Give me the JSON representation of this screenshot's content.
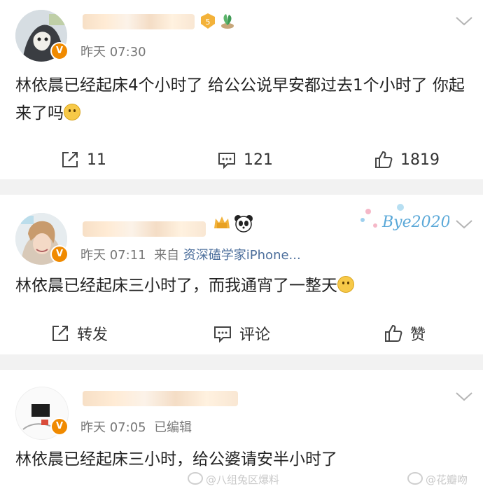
{
  "posts": [
    {
      "time": "昨天 07:30",
      "content": "林依晨已经起床4个小时了 给公公说早安都过去1个小时了 你起来了吗",
      "actions": {
        "repost": "11",
        "comment": "121",
        "like": "1819"
      }
    },
    {
      "time": "昨天 07:11",
      "source_prefix": "来自",
      "source": "资深磕学家iPhone...",
      "content": "林依晨已经起床三小时了，而我通宵了一整天",
      "card_label": "Bye2020",
      "actions": {
        "repost": "转发",
        "comment": "评论",
        "like": "赞"
      }
    },
    {
      "time": "昨天 07:05",
      "edited": "已编辑",
      "content": "林依晨已经起床三小时，给公婆请安半小时了"
    }
  ],
  "watermarks": [
    "@八组兔区爆料",
    "@花瓣吻"
  ],
  "badge": "V",
  "colors": {
    "separator": "#f2f2f2",
    "badge": "#f08a00",
    "source_link": "#4d6f9c"
  }
}
